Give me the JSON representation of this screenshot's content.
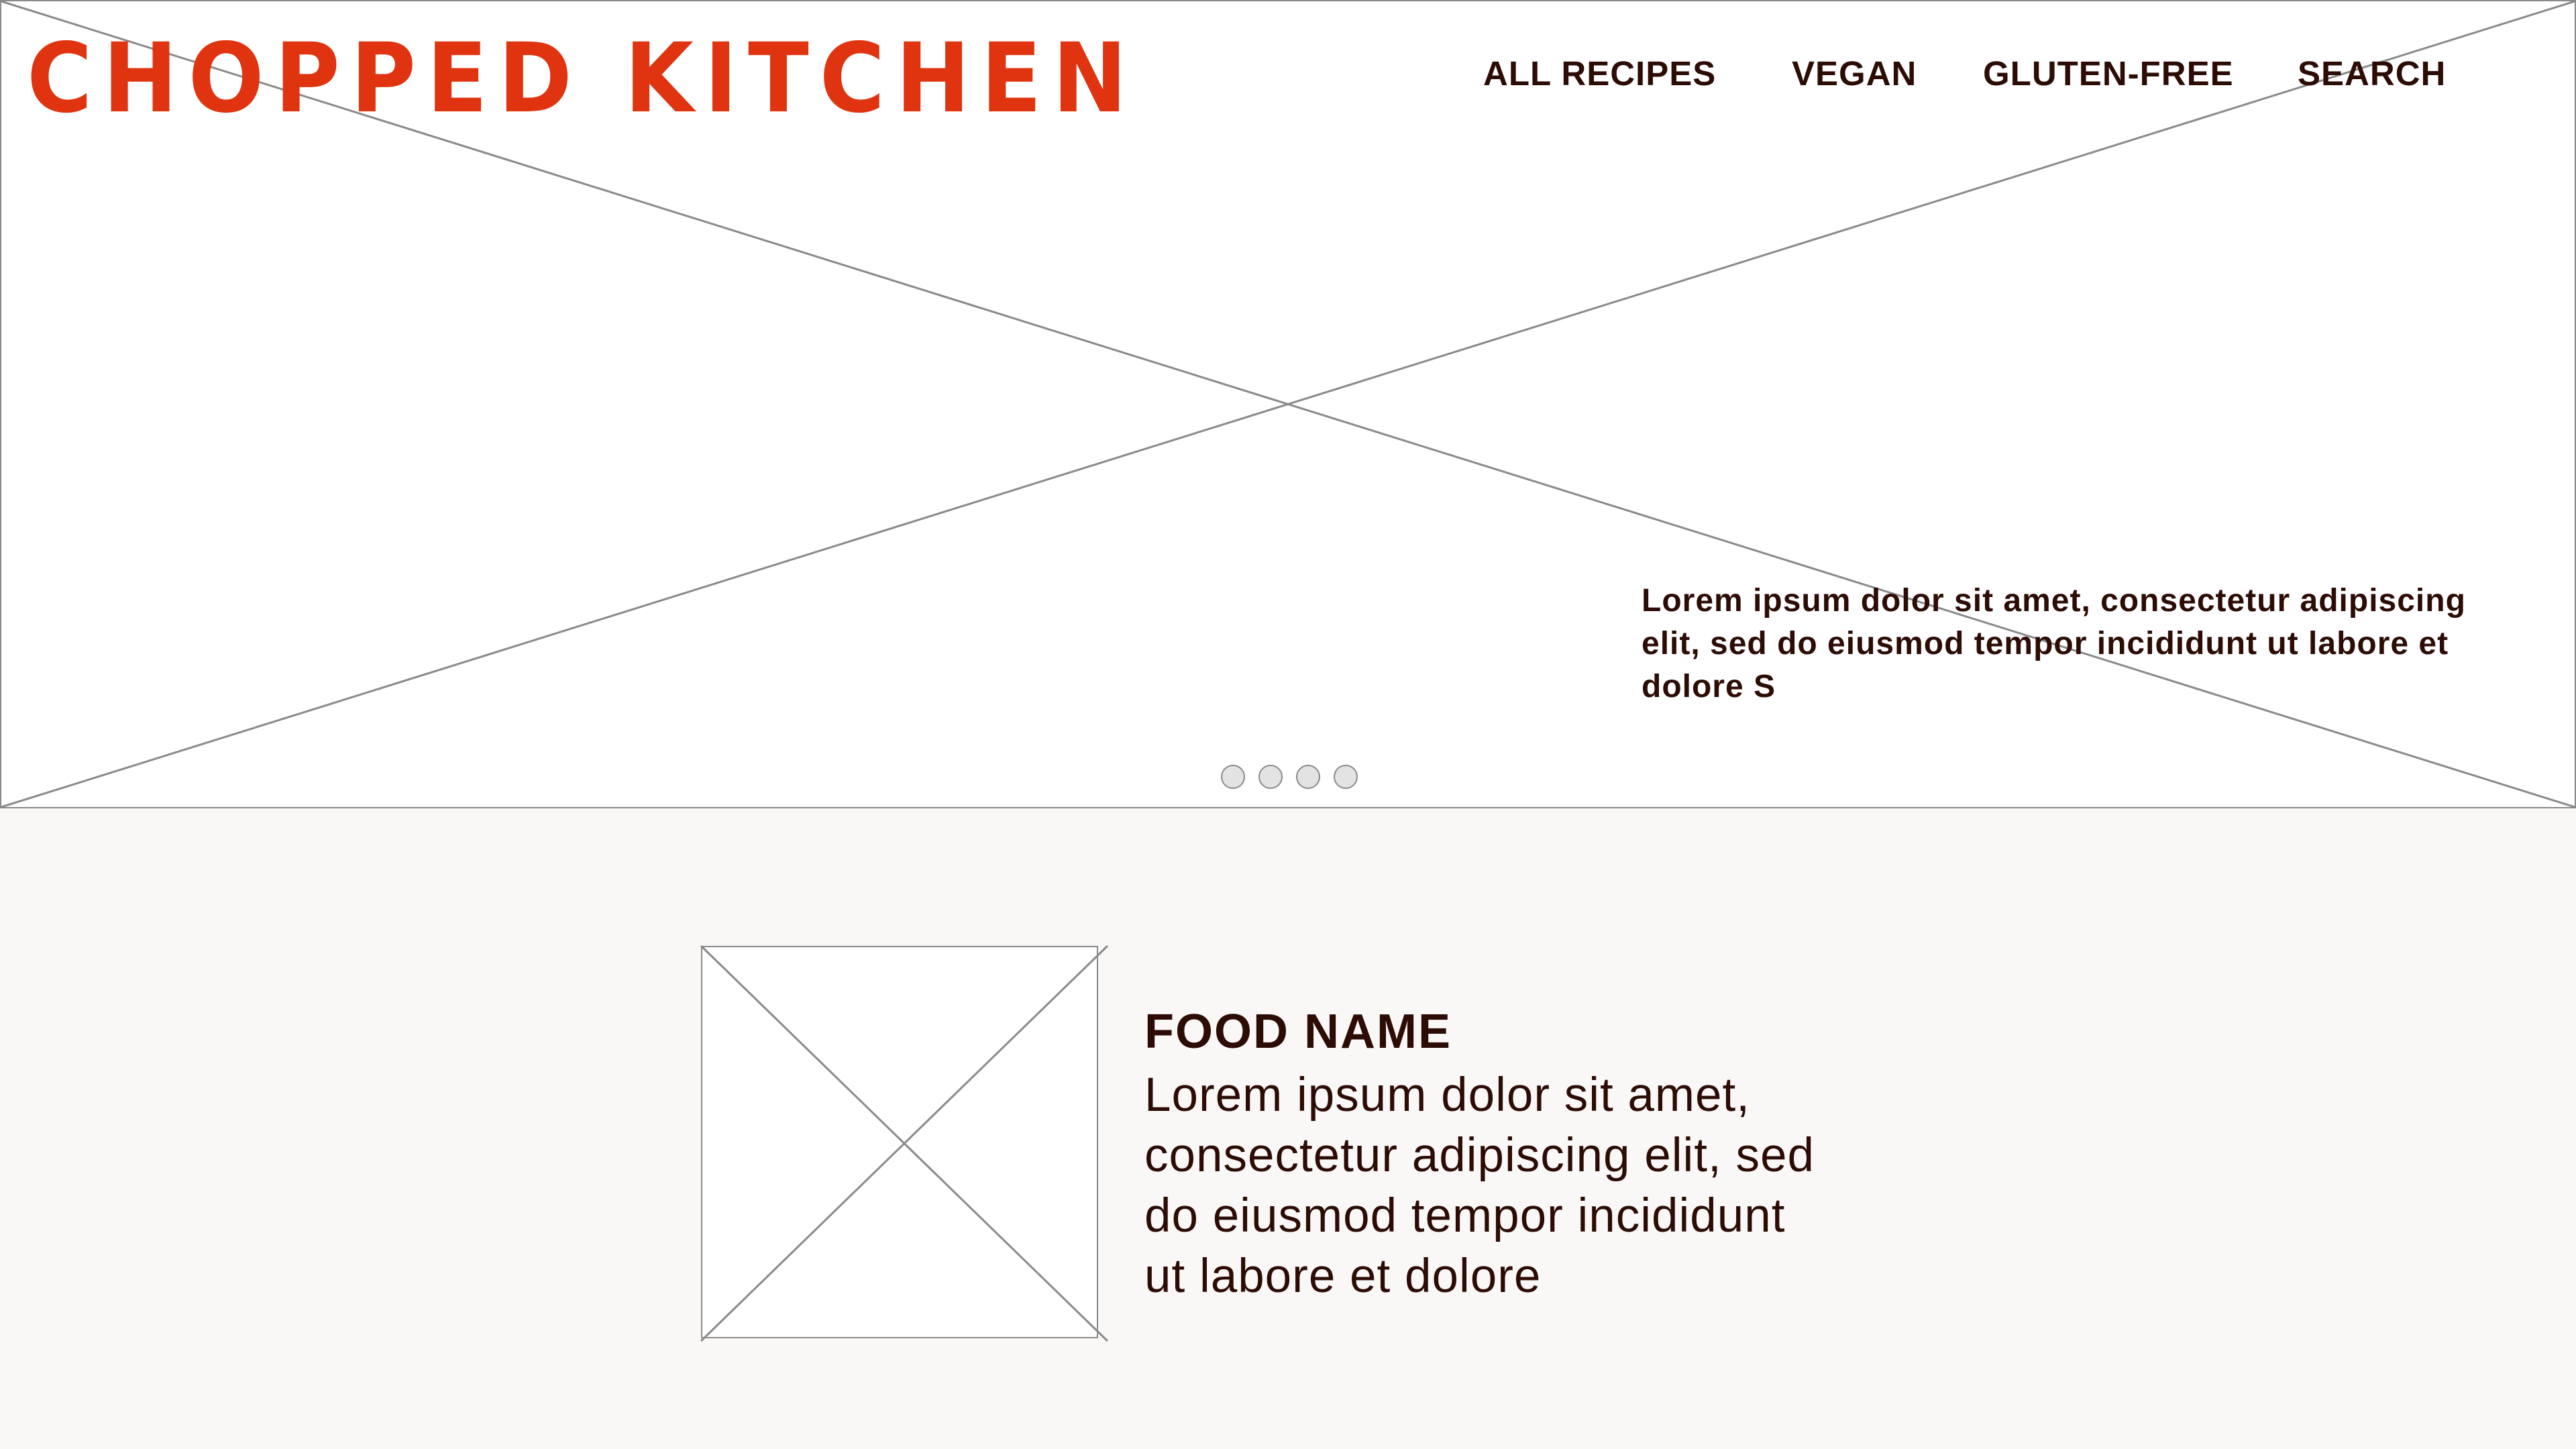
{
  "brand": {
    "logo_text": "CHOPPED KITCHEN",
    "logo_color": "#e0330f",
    "text_color": "#2d0c06"
  },
  "nav": {
    "items": [
      {
        "label": "ALL RECIPES"
      },
      {
        "label": "VEGAN"
      },
      {
        "label": "GLUTEN-FREE"
      },
      {
        "label": "SEARCH"
      }
    ]
  },
  "hero": {
    "image_icon": "image-placeholder-icon",
    "caption": "Lorem ipsum dolor sit amet, consectetur adipiscing elit, sed do eiusmod tempor incididunt ut labore et dolore S",
    "carousel": {
      "slide_count": 4
    }
  },
  "feature": {
    "image_icon": "image-placeholder-icon",
    "title": "FOOD NAME",
    "description": "Lorem ipsum dolor sit amet, consectetur adipiscing elit, sed do eiusmod tempor incididunt ut labore et dolore"
  },
  "colors": {
    "page_background": "#f9f8f6",
    "hero_background": "#ffffff",
    "placeholder_stroke": "#8a8a8a",
    "dot_fill": "#e3e3e3"
  }
}
